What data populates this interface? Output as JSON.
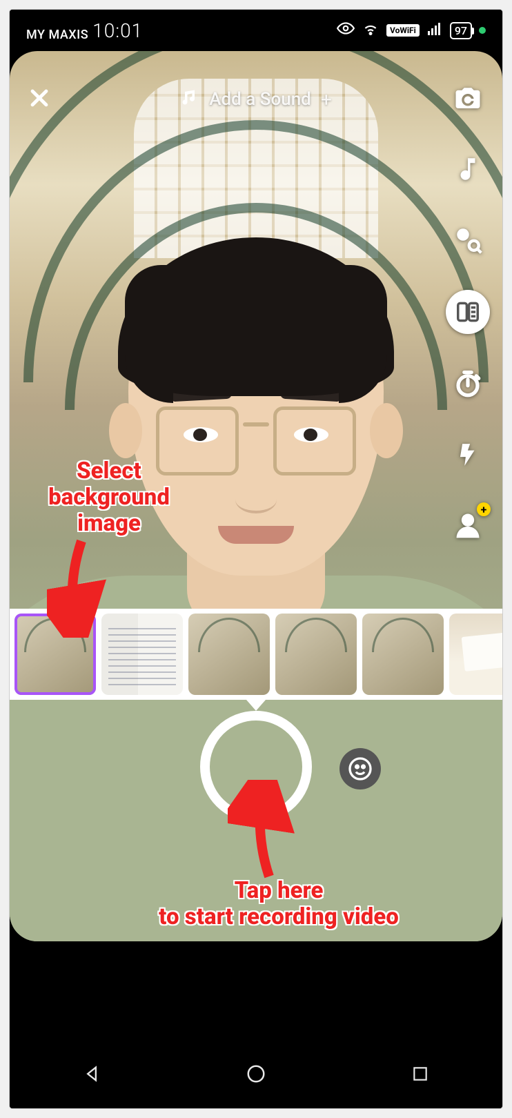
{
  "status_bar": {
    "carrier": "MY MAXIS",
    "time": "10:01",
    "vowifi": "VoWiFi",
    "battery": "97"
  },
  "top": {
    "add_sound_label": "Add a Sound"
  },
  "tools": {
    "flip": "flip-camera-icon",
    "music": "music-icon",
    "explore": "explore-icon",
    "greenscreen": "greenscreen-icon",
    "timer": "timer-icon",
    "flash": "flash-icon",
    "add_friend": "person-plus-icon"
  },
  "backgrounds": {
    "selected_index": 0,
    "thumbs": [
      {
        "kind": "hall",
        "label": "interior-arches-1"
      },
      {
        "kind": "paper",
        "label": "handwritten-note"
      },
      {
        "kind": "hall",
        "label": "interior-arches-2"
      },
      {
        "kind": "hall",
        "label": "interior-arches-3"
      },
      {
        "kind": "hall",
        "label": "interior-arches-4"
      },
      {
        "kind": "card",
        "label": "holding-card"
      }
    ]
  },
  "annotations": {
    "select_bg": "Select background image",
    "tap_record": "Tap here\nto start recording video"
  }
}
